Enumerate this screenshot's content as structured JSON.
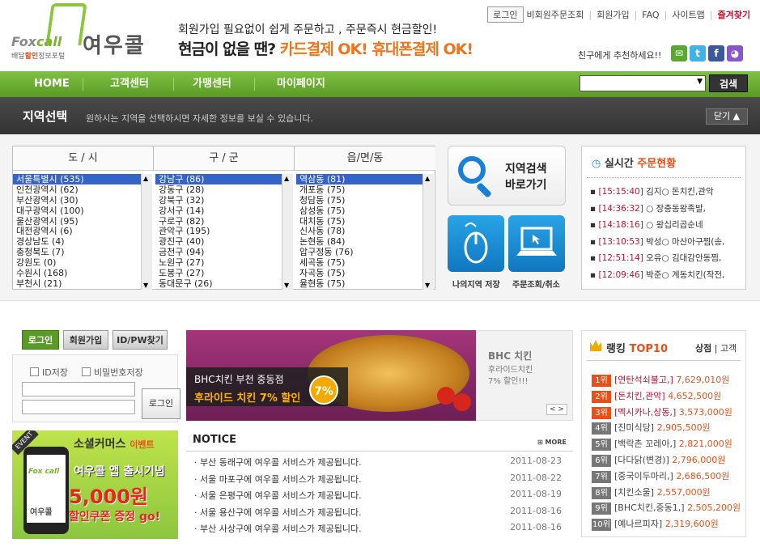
{
  "logo": {
    "fox": "Fox",
    "call": "call",
    "korean": "여우콜",
    "sub_pre": "배달",
    "sub_hl": "할인",
    "sub_post": "정보포털"
  },
  "tagline": {
    "line1": "회원가입 필요없이 쉽게 주문하고 , 주문즉시 현금할인!",
    "line2_black": "현금이 없을 땐?",
    "line2_orange": "카드결제 OK! 휴대폰결제 OK!"
  },
  "topnav": {
    "login": "로그인",
    "items": [
      "비회원주문조회",
      "회원가입",
      "FAQ",
      "사이트맵"
    ],
    "favorite": "즐겨찾기"
  },
  "recommend": "친구에게 추천하세요!!",
  "sns": [
    "mail-icon",
    "twitter-icon",
    "facebook-icon",
    "me2day-icon"
  ],
  "nav": [
    "HOME",
    "고객센터",
    "가맹센터",
    "마이페이지"
  ],
  "search": {
    "value": "",
    "button": "검색"
  },
  "region_bar": {
    "title": "지역선택",
    "desc": "원하시는 지역을 선택하시면 자세한 정보를 보실 수 있습니다.",
    "close": "닫기 ▲"
  },
  "region": {
    "col1": {
      "title": "도 / 시",
      "items": [
        "서울특별시 (535)",
        "인천광역시 (62)",
        "부산광역시 (30)",
        "대구광역시 (100)",
        "울산광역시 (95)",
        "대전광역시 (6)",
        "경상남도 (4)",
        "충청북도 (7)",
        "강원도 (0)",
        "수원시 (168)",
        "부천시 (21)"
      ]
    },
    "col2": {
      "title": "구 / 군",
      "items": [
        "강남구 (86)",
        "강동구 (28)",
        "강북구 (32)",
        "강서구 (14)",
        "구로구 (82)",
        "관악구 (195)",
        "광진구 (40)",
        "금천구 (94)",
        "노원구 (27)",
        "도봉구 (27)",
        "동대문구 (26)"
      ]
    },
    "col3": {
      "title": "읍/면/동",
      "items": [
        "역삼동 (81)",
        "개포동 (75)",
        "청담동 (75)",
        "삼성동 (75)",
        "대치동 (75)",
        "신사동 (78)",
        "논현동 (84)",
        "압구정동 (76)",
        "세곡동 (75)",
        "자곡동 (75)",
        "율현동 (75)"
      ]
    }
  },
  "region_search": {
    "line1": "지역검색",
    "line2": "바로가기"
  },
  "quick": {
    "mine": "나의지역 저장",
    "order": "주문조회/취소"
  },
  "realtime": {
    "title_black": "실시간",
    "title_orange": "주문현황",
    "items": [
      {
        "time": "[15:15:40]",
        "text": "김지○ 돈치킨,관악"
      },
      {
        "time": "[14:36:32]",
        "text": "○ 장충동왕족발,"
      },
      {
        "time": "[14:18:16]",
        "text": "○ 왕십리곱순네"
      },
      {
        "time": "[13:10:53]",
        "text": "박성○ 마산아구찜(송,"
      },
      {
        "time": "[12:51:14]",
        "text": "오유○ 김대감안동찜,"
      },
      {
        "time": "[12:09:46]",
        "text": "박준○ 계동치킨(작전,"
      }
    ]
  },
  "login": {
    "tab_login": "로그인",
    "tab_join": "회원가입",
    "tab_find": "ID/PW찾기",
    "save_id": "ID저장",
    "save_pw": "비밀번호저장",
    "submit": "로그인"
  },
  "banner": {
    "line1": "BHC치킨 부천 중동점",
    "line2": "후라이드 치킨 7% 할인",
    "badge": "7%",
    "side_title": "BHC 치킨",
    "side_sub1": "후라이드치킨",
    "side_sub2": "7% 할인!!!",
    "pager": "< >"
  },
  "event": {
    "tag": "EVENT",
    "line1a": "소셜커머스",
    "line1b": "이벤트",
    "line2": "여우콜 앱 출시기념",
    "line3": "5,000원",
    "line4": "할인쿠폰 증정 go!",
    "phone_logo": "Fox call",
    "phone_name": "여우콜"
  },
  "notice": {
    "title": "NOTICE",
    "more": "⊞ MORE",
    "items": [
      {
        "text": "· 부산 동래구에 여우콜 서비스가 제공됩니다.",
        "date": "2011-08-23"
      },
      {
        "text": "· 서울 마포구에 여우콜 서비스가 제공됩니다.",
        "date": "2011-08-22"
      },
      {
        "text": "· 서울 은평구에 여우콜 서비스가 제공됩니다.",
        "date": "2011-08-19"
      },
      {
        "text": "· 서울 용산구에 여우콜 서비스가 제공됩니다.",
        "date": "2011-08-16"
      },
      {
        "text": "· 부산 사상구에 여우콜 서비스가 제공됩니다.",
        "date": "2011-08-16"
      }
    ]
  },
  "ranking": {
    "title_black": "랭킹",
    "title_orange": "TOP10",
    "tab_store": "상점",
    "tab_customer": "고객",
    "items": [
      {
        "rank": "1위",
        "name": "[연탄석쇠불고,]",
        "amount": "7,629,010원"
      },
      {
        "rank": "2위",
        "name": "[돈치킨,관악]",
        "amount": "4,652,500원"
      },
      {
        "rank": "3위",
        "name": "[멕시카나,상동,]",
        "amount": "3,573,000원"
      },
      {
        "rank": "4위",
        "name": "[진미식당]",
        "amount": "2,905,500원"
      },
      {
        "rank": "5위",
        "name": "[백락촌 꼬레아,]",
        "amount": "2,821,000원"
      },
      {
        "rank": "6위",
        "name": "[다다닭(변경)]",
        "amount": "2,796,000원"
      },
      {
        "rank": "7위",
        "name": "[중국이두마리,]",
        "amount": "2,686,500원"
      },
      {
        "rank": "8위",
        "name": "[치킨소울]",
        "amount": "2,557,000원"
      },
      {
        "rank": "9위",
        "name": "[BHC치킨,중동1,]",
        "amount": "2,505,200원"
      },
      {
        "rank": "10위",
        "name": "[예나르피자]",
        "amount": "2,319,600원"
      }
    ]
  },
  "colors": {
    "green": "#6aad30",
    "orange": "#e8501a",
    "dark": "#3a3a3a",
    "select_blue": "#3464c8"
  }
}
